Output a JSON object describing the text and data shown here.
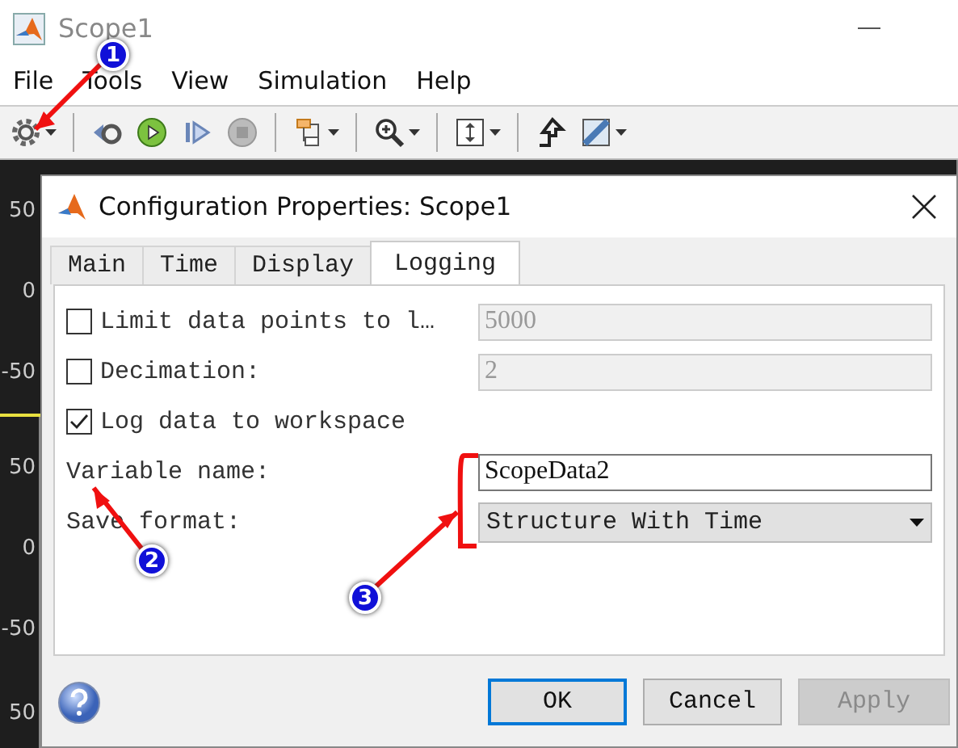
{
  "window": {
    "title": "Scope1"
  },
  "menu": [
    {
      "label": "File"
    },
    {
      "label": "Tools"
    },
    {
      "label": "View"
    },
    {
      "label": "Simulation"
    },
    {
      "label": "Help"
    }
  ],
  "toolbar": [
    {
      "kind": "gear",
      "dropdown": true
    },
    {
      "kind": "sep"
    },
    {
      "kind": "rewind",
      "dropdown": false
    },
    {
      "kind": "play",
      "dropdown": false
    },
    {
      "kind": "step",
      "dropdown": false
    },
    {
      "kind": "stop",
      "dropdown": false
    },
    {
      "kind": "sep"
    },
    {
      "kind": "blocks",
      "dropdown": true
    },
    {
      "kind": "sep"
    },
    {
      "kind": "zoom",
      "dropdown": true
    },
    {
      "kind": "sep"
    },
    {
      "kind": "fit",
      "dropdown": true
    },
    {
      "kind": "sep"
    },
    {
      "kind": "highlight",
      "dropdown": false
    },
    {
      "kind": "ruler",
      "dropdown": true
    }
  ],
  "plots": [
    {
      "ticks": [
        "50",
        "0",
        "-50"
      ]
    },
    {
      "ticks": [
        "50",
        "0",
        "-50"
      ]
    },
    {
      "ticks": [
        "50"
      ]
    }
  ],
  "dialog": {
    "title": "Configuration Properties: Scope1",
    "tabs": [
      {
        "label": "Main",
        "selected": false
      },
      {
        "label": "Time",
        "selected": false
      },
      {
        "label": "Display",
        "selected": false
      },
      {
        "label": "Logging",
        "selected": true
      }
    ],
    "rows": [
      {
        "kind": "checkbox",
        "label": "Limit data points to l…",
        "checked": false,
        "value": "5000",
        "disabled": true
      },
      {
        "kind": "checkbox",
        "label": "Decimation:",
        "checked": false,
        "value": "2",
        "disabled": true
      },
      {
        "kind": "checkbox",
        "label": "Log data to workspace",
        "checked": true
      },
      {
        "kind": "text",
        "label": "Variable name:",
        "value": "ScopeData2"
      },
      {
        "kind": "dropdown",
        "label": "Save format:",
        "value": "Structure With Time"
      }
    ],
    "buttons": [
      {
        "label": "OK",
        "focused": true,
        "disabled": false
      },
      {
        "label": "Cancel",
        "focused": false,
        "disabled": false
      },
      {
        "label": "Apply",
        "focused": false,
        "disabled": true
      }
    ]
  },
  "annotations": [
    {
      "label": "1"
    },
    {
      "label": "2"
    },
    {
      "label": "3"
    }
  ]
}
